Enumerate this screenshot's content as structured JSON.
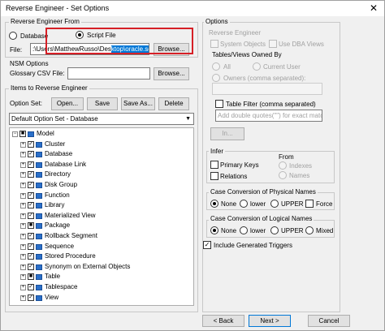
{
  "window": {
    "title": "Reverse Engineer - Set Options",
    "close": "✕"
  },
  "reverse_from": {
    "group_label": "Reverse Engineer From",
    "database_label": "Database",
    "script_file_label": "Script File",
    "selected": "Script File",
    "file_label": "File:",
    "file_path_plain": ":\\Users\\MatthewRusso\\Des",
    "file_path_selected": "ktop\\oracle.sql",
    "browse_label": "Browse..."
  },
  "nsm": {
    "group_label": "NSM Options",
    "glossary_label": "Glossary CSV File:",
    "glossary_value": "",
    "browse_label": "Browse..."
  },
  "items": {
    "group_label": "Items to Reverse Engineer",
    "option_set_label": "Option Set:",
    "open_label": "Open...",
    "save_label": "Save",
    "save_as_label": "Save As...",
    "delete_label": "Delete",
    "option_set_value": "Default Option Set - Database",
    "tree": [
      {
        "label": "Model",
        "level": 0,
        "expander": "−",
        "check": "■"
      },
      {
        "label": "Cluster",
        "level": 1,
        "expander": "+",
        "check": "✓"
      },
      {
        "label": "Database",
        "level": 1,
        "expander": "+",
        "check": "✓"
      },
      {
        "label": "Database Link",
        "level": 1,
        "expander": "+",
        "check": "✓"
      },
      {
        "label": "Directory",
        "level": 1,
        "expander": "+",
        "check": "✓"
      },
      {
        "label": "Disk Group",
        "level": 1,
        "expander": "+",
        "check": "✓"
      },
      {
        "label": "Function",
        "level": 1,
        "expander": "+",
        "check": "✓"
      },
      {
        "label": "Library",
        "level": 1,
        "expander": "+",
        "check": "✓"
      },
      {
        "label": "Materialized View",
        "level": 1,
        "expander": "+",
        "check": "✓"
      },
      {
        "label": "Package",
        "level": 1,
        "expander": "+",
        "check": "■"
      },
      {
        "label": "Rollback Segment",
        "level": 1,
        "expander": "+",
        "check": "✓"
      },
      {
        "label": "Sequence",
        "level": 1,
        "expander": "+",
        "check": "✓"
      },
      {
        "label": "Stored Procedure",
        "level": 1,
        "expander": "+",
        "check": "✓"
      },
      {
        "label": "Synonym on External Objects",
        "level": 1,
        "expander": "+",
        "check": "✓"
      },
      {
        "label": "Table",
        "level": 1,
        "expander": "+",
        "check": "■"
      },
      {
        "label": "Tablespace",
        "level": 1,
        "expander": "+",
        "check": "✓"
      },
      {
        "label": "View",
        "level": 1,
        "expander": "+",
        "check": "✓"
      }
    ]
  },
  "options": {
    "group_label": "Options",
    "re_label": "Reverse Engineer",
    "system_objects": "System Objects",
    "use_dba_views": "Use DBA Views",
    "tables_owned_label": "Tables/Views Owned By",
    "all": "All",
    "current_user": "Current User",
    "owners": "Owners (comma separated):",
    "table_filter": "Table Filter (comma separated)",
    "table_filter_placeholder": "Add double quotes(\"\") for exact match",
    "in_button": "In...",
    "infer_label": "Infer",
    "primary_keys": "Primary Keys",
    "relations": "Relations",
    "from_label": "From",
    "indexes": "Indexes",
    "names": "Names",
    "physical_label": "Case Conversion of Physical Names",
    "logical_label": "Case Conversion of Logical Names",
    "none": "None",
    "lower": "lower",
    "upper": "UPPER",
    "force": "Force",
    "mixed": "Mixed",
    "include_triggers": "Include Generated Triggers"
  },
  "footer": {
    "back": "< Back",
    "next": "Next >",
    "cancel": "Cancel"
  },
  "colors": {
    "highlight": "#0078d7",
    "annotation": "#d61f26"
  }
}
